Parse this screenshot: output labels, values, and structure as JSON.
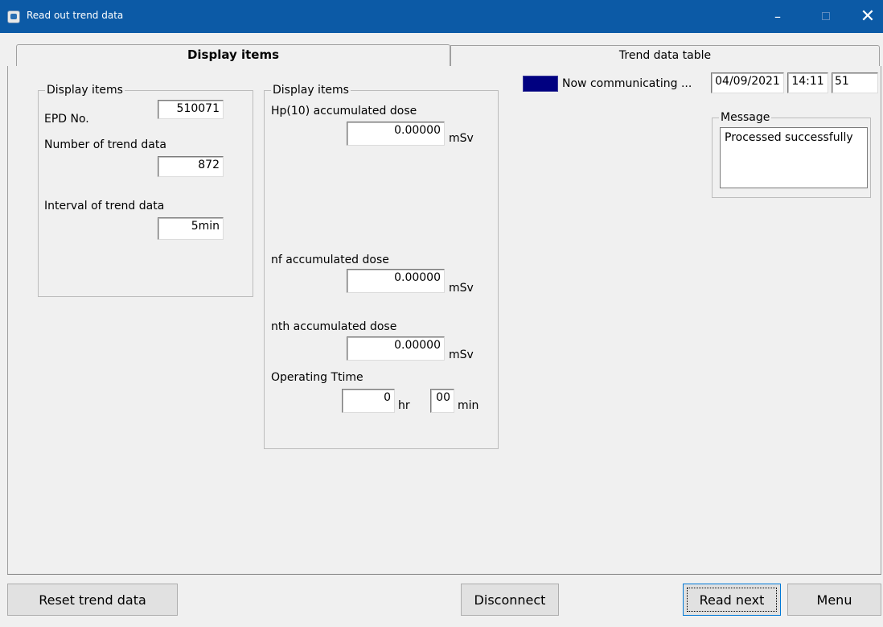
{
  "window": {
    "title": "Read out trend data",
    "min": "–",
    "close": "✕"
  },
  "tabs": [
    {
      "label": "Display items",
      "active": true
    },
    {
      "label": "Trend data table",
      "active": false
    }
  ],
  "left_group": {
    "title": "Display items",
    "epd_label": "EPD No.",
    "epd_value": "510071",
    "count_label": "Number of trend data",
    "count_value": "872",
    "interval_label": "Interval of trend data",
    "interval_value": "5min"
  },
  "middle_group": {
    "title": "Display items",
    "hp10_label": "Hp(10) accumulated dose",
    "hp10_value": "0.00000",
    "nf_label": "nf accumulated dose",
    "nf_value": "0.00000",
    "nth_label": "nth accumulated dose",
    "nth_value": "0.00000",
    "unit": "mSv",
    "optime_label": "Operating Ttime",
    "hours_value": "0",
    "hours_unit": "hr",
    "minutes_value": "00",
    "minutes_unit": "min"
  },
  "status": {
    "indicator_color": "#000080",
    "comm_text": "Now communicating ...",
    "date": "04/09/2021",
    "time": "14:11",
    "seconds": "51"
  },
  "message": {
    "title": "Message",
    "text": "Processed successfully"
  },
  "buttons": {
    "reset": "Reset trend data",
    "disconnect": "Disconnect",
    "read_next": "Read next",
    "menu": "Menu"
  }
}
